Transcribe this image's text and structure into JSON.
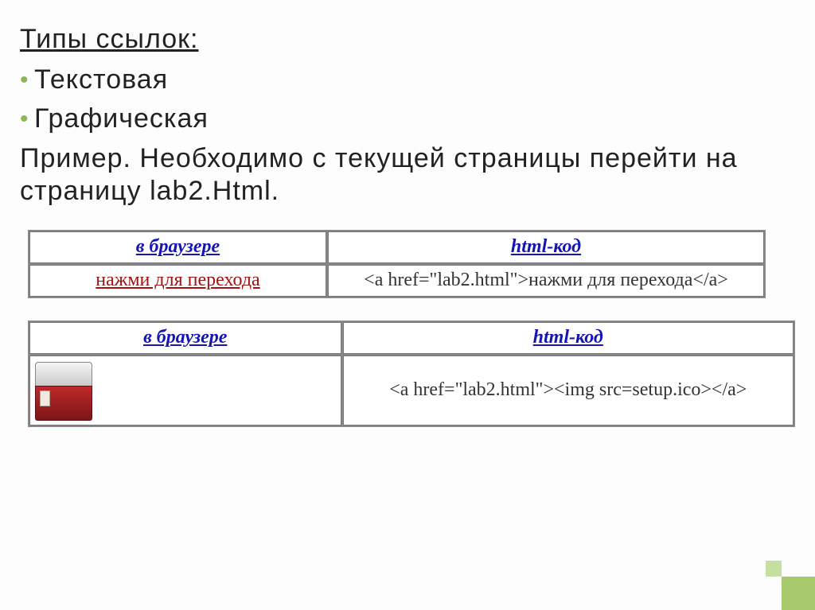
{
  "heading": "Типы ссылок:",
  "bullets": [
    "Текстовая",
    "Графическая"
  ],
  "paragraph": "Пример. Необходимо с текущей страницы перейти на страницу lab2.Html.",
  "table1": {
    "h1": "в браузере",
    "h2": "html-код",
    "link_text": "нажми для перехода",
    "code": "<a href=\"lab2.html\">нажми для перехода</a>"
  },
  "table2": {
    "h1": "в браузере",
    "h2": "html-код",
    "code": "<a href=\"lab2.html\"><img src=setup.ico></a>"
  }
}
